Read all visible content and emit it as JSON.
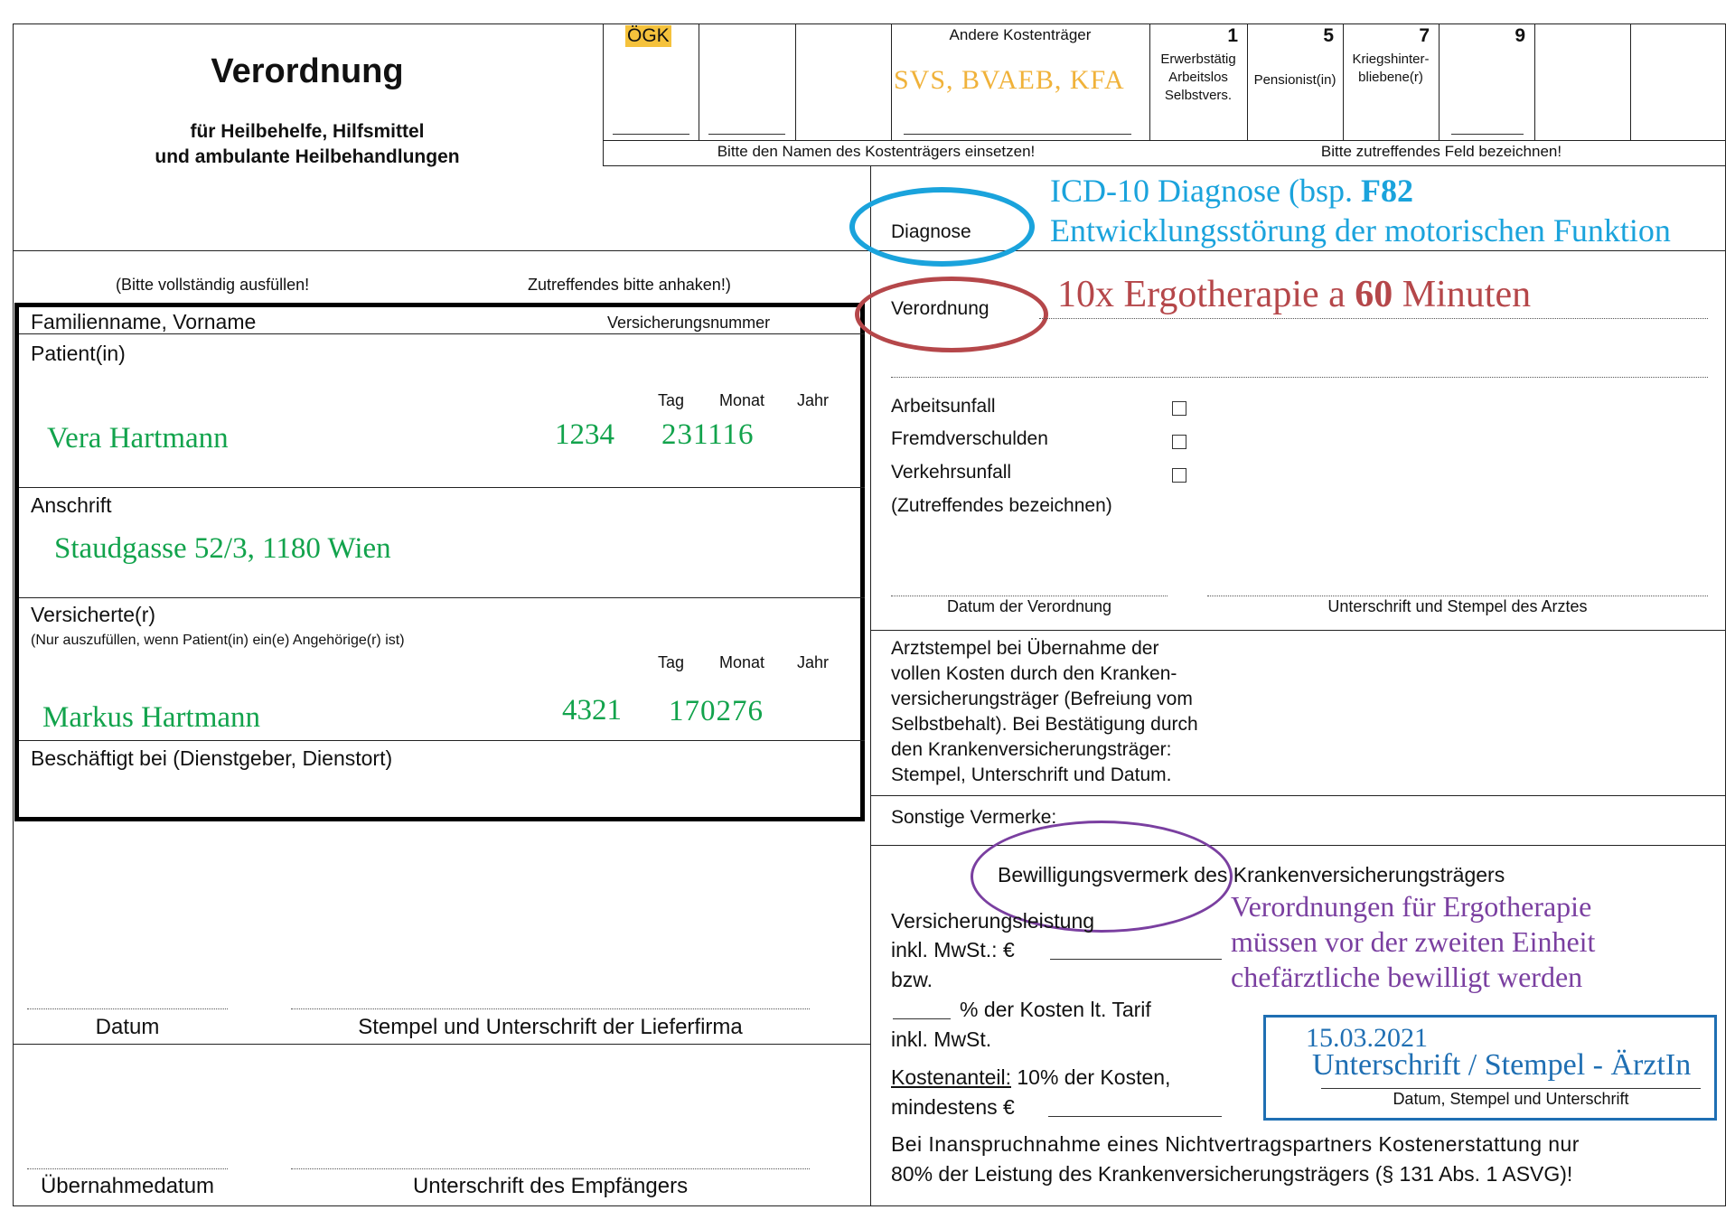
{
  "header": {
    "title": "Verordnung",
    "subtitle_line1": "für Heilbehelfe, Hilfsmittel",
    "subtitle_line2": "und ambulante Heilbehandlungen"
  },
  "kostentraeger": {
    "ogk": "ÖGK",
    "andere_label": "Andere Kostenträger",
    "andere_value": "SVS, BVAEB, KFA",
    "hint_name": "Bitte den Namen des Kostenträgers einsetzen!",
    "hint_feld": "Bitte zutreffendes Feld bezeichnen!",
    "cat1_num": "1",
    "cat1_l1": "Erwerbstätig",
    "cat1_l2": "Arbeitslos",
    "cat1_l3": "Selbstvers.",
    "cat5_num": "5",
    "cat5_l1": "Pensionist(in)",
    "cat7_num": "7",
    "cat7_l1": "Kriegshinter-",
    "cat7_l2": "bliebene(r)",
    "cat9_num": "9"
  },
  "diagnose": {
    "label": "Diagnose",
    "note_line1_prefix": "ICD-10 Diagnose (bsp. ",
    "note_line1_bold": "F82",
    "note_line2": "Entwicklungsstörung der motorischen Funktion"
  },
  "verordnung_row": {
    "label": "Verordnung",
    "note_prefix": "10x Ergotherapie a ",
    "note_bold": "60",
    "note_suffix": " Minuten"
  },
  "instructions": {
    "left": "(Bitte vollständig ausfüllen!",
    "right": "Zutreffendes bitte anhaken!)"
  },
  "patient": {
    "name_label": "Familienname, Vorname",
    "versnr_label": "Versicherungsnummer",
    "section_label": "Patient(in)",
    "tag": "Tag",
    "monat": "Monat",
    "jahr": "Jahr",
    "name_value": "Vera Hartmann",
    "versnr_value": "1234",
    "birth_value": "231116"
  },
  "anschrift": {
    "label": "Anschrift",
    "value": "Staudgasse 52/3, 1180 Wien"
  },
  "versicherter": {
    "label": "Versicherte(r)",
    "note": "(Nur auszufüllen, wenn Patient(in) ein(e) Angehörige(r) ist)",
    "tag": "Tag",
    "monat": "Monat",
    "jahr": "Jahr",
    "name_value": "Markus Hartmann",
    "versnr_value": "4321",
    "birth_value": "170276"
  },
  "beschaeftigt": {
    "label": "Beschäftigt bei (Dienstgeber, Dienstort)"
  },
  "unfall": {
    "arbeitsunfall": "Arbeitsunfall",
    "fremdverschulden": "Fremdverschulden",
    "verkehrsunfall": "Verkehrsunfall",
    "hint": "(Zutreffendes bezeichnen)"
  },
  "signatures": {
    "datum_verordnung": "Datum der Verordnung",
    "unterschrift_arzt": "Unterschrift und Stempel des Arztes"
  },
  "arztstempel": {
    "l1": "Arztstempel bei Übernahme der",
    "l2": "vollen Kosten durch den Kranken-",
    "l3": "versicherungsträger (Befreiung vom",
    "l4": "Selbstbehalt). Bei Bestätigung durch",
    "l5": "den Krankenversicherungsträger:",
    "l6": "Stempel, Unterschrift und Datum."
  },
  "sonstige": {
    "label": "Sonstige Vermerke:"
  },
  "bewilligung": {
    "label_circled": "Bewilligungsvermerk",
    "label_rest": " des Krankenversicherungsträgers",
    "note_l1": "Verordnungen für Ergotherapie",
    "note_l2": "müssen vor der zweiten Einheit",
    "note_l3": "chefärztliche bewilligt werden",
    "versicherungsleistung": "Versicherungsleistung",
    "inkl_mwst_eur": "inkl. MwSt.: €",
    "bzw": "bzw.",
    "prozent": "% der Kosten lt. Tarif",
    "inkl_mwst": "inkl. MwSt.",
    "kostenanteil_u": "Kostenanteil:",
    "kostenanteil_rest": " 10% der Kosten,",
    "mindestens": "mindestens €",
    "nichtvertrag_l1": "Bei Inanspruchnahme eines Nichtvertragspartners Kostenerstattung nur",
    "nichtvertrag_l2": "80% der Leistung des Krankenversicherungsträgers (§ 131 Abs. 1 ASVG)!"
  },
  "stamp_box": {
    "date": "15.03.2021",
    "signature": "Unterschrift / Stempel - ÄrztIn",
    "caption": "Datum, Stempel und Unterschrift"
  },
  "lieferung": {
    "datum": "Datum",
    "stempel": "Stempel und Unterschrift der Lieferfirma",
    "uebernahmedatum": "Übernahmedatum",
    "empfaenger": "Unterschrift des Empfängers"
  },
  "colors": {
    "green_handwriting": "#12a34c",
    "blue_annotation": "#1aa3dc",
    "red_annotation": "#b5474a",
    "purple_annotation": "#7a3fa0",
    "stamp_blue": "#1f6fb3",
    "highlight_yellow": "#f5c23c",
    "orange_text": "#f0b23a"
  }
}
